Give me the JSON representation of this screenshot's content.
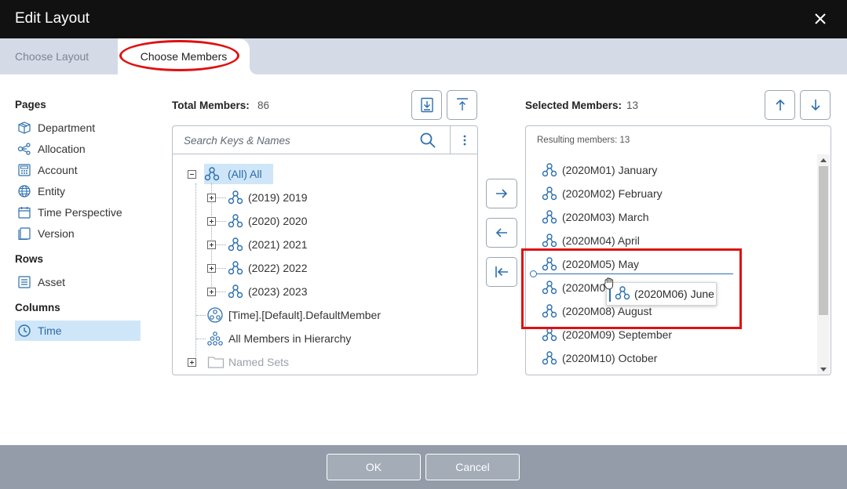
{
  "window": {
    "title": "Edit Layout"
  },
  "tabs": [
    {
      "label": "Choose Layout"
    },
    {
      "label": "Choose Members"
    }
  ],
  "sidebar": {
    "pages_title": "Pages",
    "pages": [
      {
        "label": "Department",
        "icon": "cube-icon"
      },
      {
        "label": "Allocation",
        "icon": "allocation-icon"
      },
      {
        "label": "Account",
        "icon": "calculator-icon"
      },
      {
        "label": "Entity",
        "icon": "globe-icon"
      },
      {
        "label": "Time Perspective",
        "icon": "calendar-icon"
      },
      {
        "label": "Version",
        "icon": "copy-icon"
      }
    ],
    "rows_title": "Rows",
    "rows": [
      {
        "label": "Asset",
        "icon": "list-icon"
      }
    ],
    "columns_title": "Columns",
    "columns": [
      {
        "label": "Time",
        "icon": "clock-icon"
      }
    ]
  },
  "total": {
    "label": "Total Members:",
    "count": "86",
    "search_placeholder": "Search Keys & Names",
    "tree": [
      {
        "label": "(All) All"
      },
      {
        "label": "(2019) 2019"
      },
      {
        "label": "(2020) 2020"
      },
      {
        "label": "(2021) 2021"
      },
      {
        "label": "(2022) 2022"
      },
      {
        "label": "(2023) 2023"
      },
      {
        "label": "[Time].[Default].DefaultMember"
      },
      {
        "label": "All Members in Hierarchy"
      },
      {
        "label": "Named Sets"
      }
    ]
  },
  "selected": {
    "label": "Selected Members:",
    "count": "13",
    "resulting": "Resulting members: 13",
    "items": [
      "(2020M01) January",
      "(2020M02) February",
      "(2020M03) March",
      "(2020M04) April",
      "(2020M05) May",
      "(2020M0",
      "(2020M08) August",
      "(2020M09) September",
      "(2020M10) October"
    ],
    "drag_ghost": "(2020M06) June"
  },
  "footer": {
    "ok": "OK",
    "cancel": "Cancel"
  },
  "colors": {
    "accent": "#2c6fad",
    "highlight": "#cfe6f9",
    "annotation": "#e01010"
  }
}
